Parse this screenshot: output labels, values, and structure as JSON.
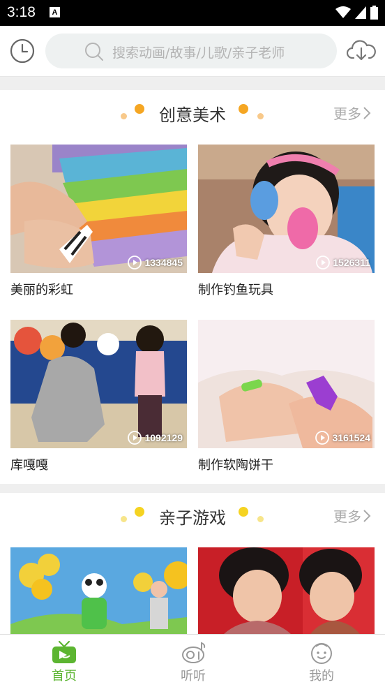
{
  "status_bar": {
    "time": "3:18",
    "notification_badge": "A"
  },
  "search": {
    "placeholder": "搜索动画/故事/儿歌/亲子老师"
  },
  "sections": [
    {
      "title": "创意美术",
      "more_label": "更多",
      "videos": [
        {
          "title": "美丽的彩虹",
          "plays": "1334845"
        },
        {
          "title": "制作钓鱼玩具",
          "plays": "1526311"
        },
        {
          "title": "库嘎嘎",
          "plays": "1092129"
        },
        {
          "title": "制作软陶饼干",
          "plays": "3161524"
        }
      ]
    },
    {
      "title": "亲子游戏",
      "more_label": "更多"
    }
  ],
  "tabs": [
    {
      "label": "首页",
      "icon": "tv-icon",
      "active": true
    },
    {
      "label": "听听",
      "icon": "radio-icon",
      "active": false
    },
    {
      "label": "我的",
      "icon": "kid-face-icon",
      "active": false
    }
  ],
  "colors": {
    "accent": "#5cb531",
    "dot": "#f5a623"
  }
}
